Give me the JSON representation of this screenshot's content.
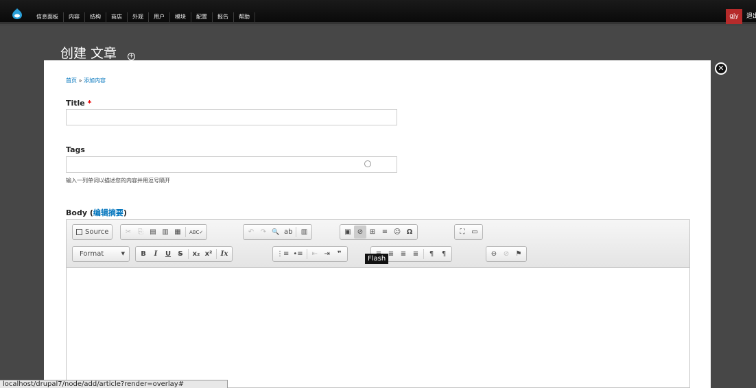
{
  "toolbar": {
    "menu": [
      "信息面板",
      "内容",
      "结构",
      "商店",
      "外观",
      "用户",
      "模块",
      "配置",
      "报告",
      "帮助"
    ],
    "user": "gjy",
    "logout": "退出",
    "colors": {
      "bg": "#111111",
      "user_bg": "#b62b2b"
    }
  },
  "overlay": {
    "title": "创建 文章",
    "shortcut_symbol": "+",
    "close_symbol": "✕"
  },
  "breadcrumb": {
    "home": "首页",
    "sep": " » ",
    "current": "添加内容"
  },
  "form": {
    "title_label": "Title",
    "required_mark": "*",
    "title_value": "",
    "tags_label": "Tags",
    "tags_value": "",
    "tags_description": "输入一列单词以描述您的内容并用逗号隔开",
    "body_label": "Body",
    "body_summary_link": "编辑摘要",
    "body_paren_open": " (",
    "body_paren_close": ")"
  },
  "editor": {
    "source_label": "Source",
    "format_label": "Format",
    "tooltip": "Flash",
    "row1": {
      "clipboard": [
        "✂",
        "⎘",
        "▤",
        "▥",
        "▦"
      ],
      "spell": "ABC✓",
      "undo": [
        "↶",
        "↷"
      ],
      "find": [
        "🔍",
        "ab"
      ],
      "maximize_icons": [
        "⛶",
        "▭"
      ],
      "insert": [
        "▣",
        "⊘",
        "⊞",
        "≡",
        "☺",
        "Ω"
      ],
      "misc": [
        "⛶",
        "▭"
      ]
    },
    "row2": {
      "basic": [
        "B",
        "I",
        "U",
        "S"
      ],
      "scripts": [
        "x₂",
        "x²"
      ],
      "clear": "Ix",
      "lists": [
        "⋮≡",
        "•≡"
      ],
      "indent": [
        "⇤",
        "⇥",
        "❞"
      ],
      "align": [
        "≡",
        "≡",
        "≡",
        "≡"
      ],
      "bidi": [
        "¶",
        "¶"
      ],
      "links": [
        "⊖",
        "⊘",
        "⚑"
      ]
    }
  },
  "statusbar": {
    "url": "localhost/drupal7/node/add/article?render=overlay#"
  }
}
